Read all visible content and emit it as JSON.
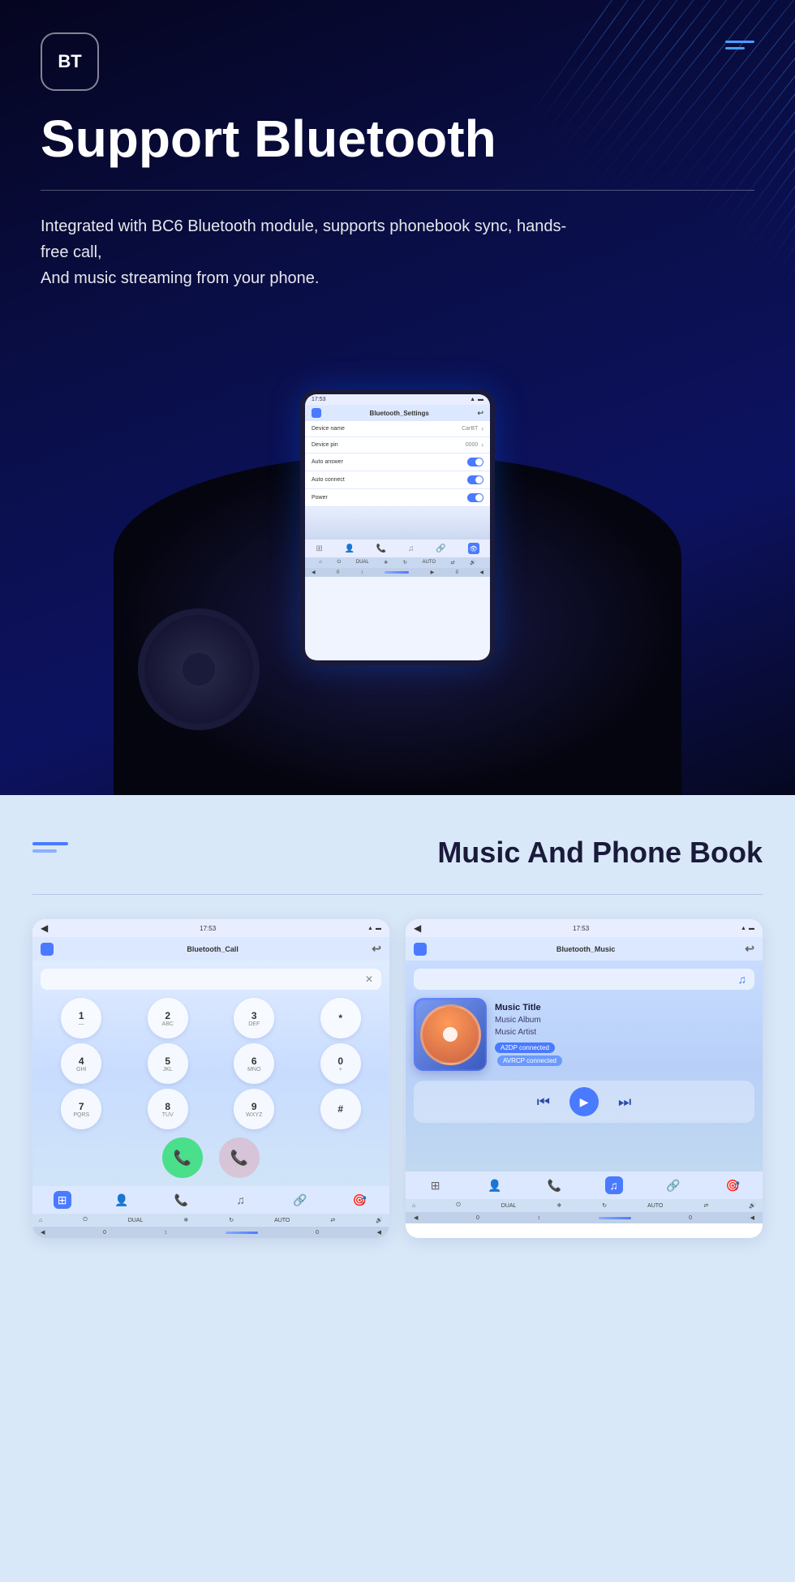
{
  "hero": {
    "bt_badge": "BT",
    "title": "Support Bluetooth",
    "divider": true,
    "description_line1": "Integrated with BC6 Bluetooth module, supports phonebook sync, hands-free call,",
    "description_line2": "And music streaming from your phone.",
    "screen": {
      "statusbar_time": "17:53",
      "header_title": "Bluetooth_Settings",
      "rows": [
        {
          "label": "Device name",
          "value": "CarBT",
          "type": "chevron"
        },
        {
          "label": "Device pin",
          "value": "0000",
          "type": "chevron"
        },
        {
          "label": "Auto answer",
          "value": "",
          "type": "toggle"
        },
        {
          "label": "Auto connect",
          "value": "",
          "type": "toggle"
        },
        {
          "label": "Power",
          "value": "",
          "type": "toggle"
        }
      ]
    }
  },
  "bottom": {
    "menu_lines": [
      "long",
      "short"
    ],
    "title": "Music And Phone Book",
    "call_screen": {
      "statusbar_time": "17:53",
      "header_title": "Bluetooth_Call",
      "dial_keys": [
        {
          "main": "1",
          "sub": "—"
        },
        {
          "main": "2",
          "sub": "ABC"
        },
        {
          "main": "3",
          "sub": "DEF"
        },
        {
          "main": "*",
          "sub": ""
        },
        {
          "main": "4",
          "sub": "GHI"
        },
        {
          "main": "5",
          "sub": "JKL"
        },
        {
          "main": "6",
          "sub": "MNO"
        },
        {
          "main": "0",
          "sub": "+"
        },
        {
          "main": "7",
          "sub": "PQRS"
        },
        {
          "main": "8",
          "sub": "TUV"
        },
        {
          "main": "9",
          "sub": "WXYZ"
        },
        {
          "main": "#",
          "sub": ""
        }
      ]
    },
    "music_screen": {
      "statusbar_time": "17:53",
      "header_title": "Bluetooth_Music",
      "music_title": "Music Title",
      "music_album": "Music Album",
      "music_artist": "Music Artist",
      "badge1": "A2DP connected",
      "badge2": "AVRCP connected"
    }
  }
}
